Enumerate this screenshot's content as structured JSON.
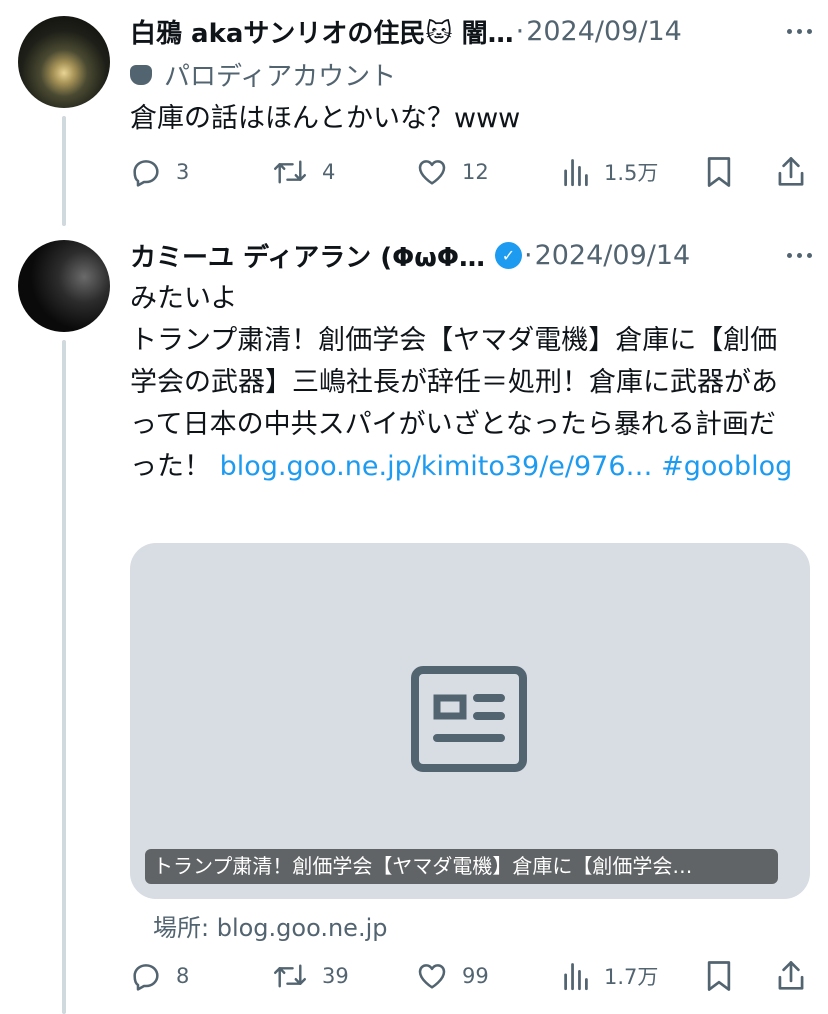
{
  "tweets": [
    {
      "display_name": "白鴉 akaサンリオの住民🐱 闇…",
      "date": "2024/09/14",
      "parody_label": "パロディアカウント",
      "text": "倉庫の話はほんとかいな？www",
      "stats": {
        "replies": "3",
        "retweets": "4",
        "likes": "12",
        "views": "1.5万"
      }
    },
    {
      "display_name": "カミーユ ディアラン (ΦωΦ…",
      "verified_icon": "verified-badge-icon",
      "date": "2024/09/14",
      "text": "みたいよ\nトランプ粛清！創価学会【ヤマダ電機】倉庫に【創価学会の武器】三嶋社長が辞任＝処刑！倉庫に武器があって日本の中共スパイがいざとなったら暴れる計画だった！",
      "link_text": "blog.goo.ne.jp/kimito39/e/976…",
      "hashtag": "#gooblog",
      "card": {
        "title": "トランプ粛清！創価学会【ヤマダ電機】倉庫に【創価学会…",
        "source": "場所: blog.goo.ne.jp"
      },
      "stats": {
        "replies": "8",
        "retweets": "39",
        "likes": "99",
        "views": "1.7万"
      }
    }
  ],
  "separator": "·",
  "colors": {
    "text": "#0f1419",
    "muted": "#536471",
    "link": "#1d9bf0",
    "thread_line": "#cfd9de",
    "card_bg": "#d8dde3"
  }
}
